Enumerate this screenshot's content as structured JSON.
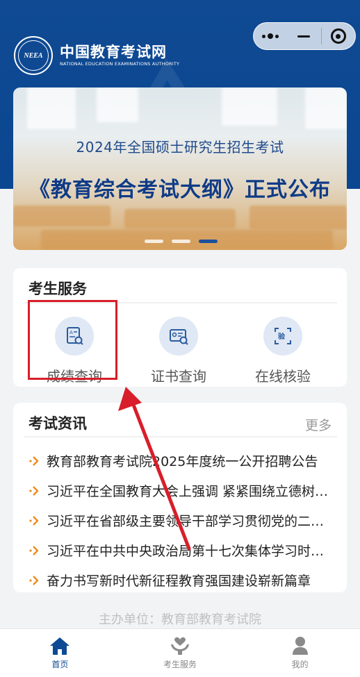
{
  "header": {
    "logo_cn": "中国教育考试网",
    "logo_en": "NATIONAL EDUCATION EXAMINATIONS AUTHORITY",
    "emblem_text": "NEEA"
  },
  "capsule": {
    "more_icon": "more-dots-icon",
    "minimize_icon": "minimize-icon",
    "close_icon": "target-close-icon"
  },
  "banner": {
    "subtitle": "2024年全国硕士研究生招生考试",
    "title": "《教育综合考试大纲》正式公布",
    "slide_count": 3,
    "active_slide": 3
  },
  "services": {
    "title": "考生服务",
    "items": [
      {
        "label": "成绩查询",
        "icon": "score-query-icon"
      },
      {
        "label": "证书查询",
        "icon": "certificate-query-icon"
      },
      {
        "label": "在线核验",
        "icon": "online-verify-icon"
      }
    ]
  },
  "news": {
    "title": "考试资讯",
    "more_label": "更多",
    "items": [
      "教育部教育考试院2025年度统一公开招聘公告",
      "习近平在全国教育大会上强调 紧紧围绕立德树人根本任务",
      "习近平在省部级主要领导干部学习贯彻党的二十届三中全会精神",
      "习近平在中共中央政治局第十七次集体学习时强调",
      "奋力书写新时代新征程教育强国建设崭新篇章"
    ]
  },
  "footer": {
    "sponsor": "主办单位：教育部教育考试院"
  },
  "tabbar": {
    "items": [
      {
        "label": "首页",
        "icon": "home-icon",
        "active": true
      },
      {
        "label": "考生服务",
        "icon": "heart-hand-icon",
        "active": false
      },
      {
        "label": "我的",
        "icon": "user-icon",
        "active": false
      }
    ]
  },
  "colors": {
    "brand_blue": "#0b4690",
    "highlight_red": "#d81e2a",
    "news_arrow_orange": "#f08a1c"
  }
}
